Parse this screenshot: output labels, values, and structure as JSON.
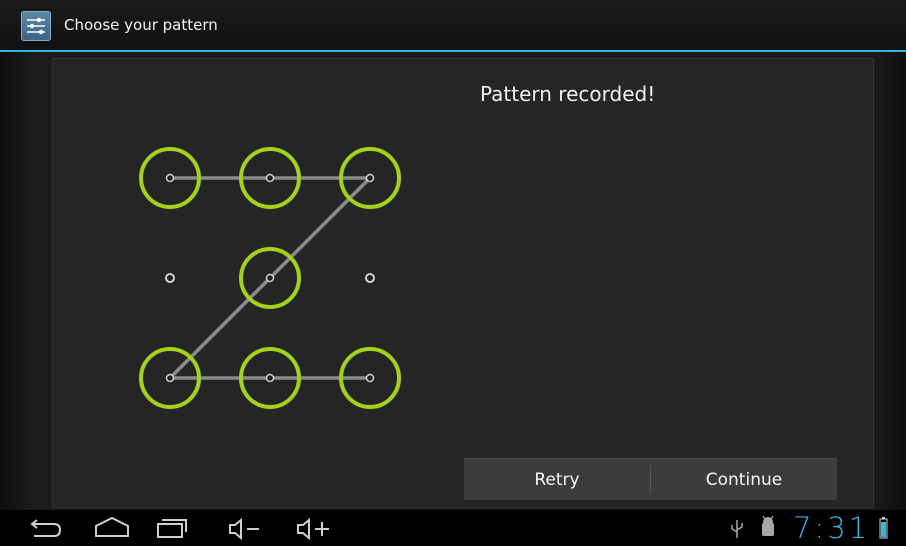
{
  "action_bar": {
    "title": "Choose your pattern",
    "app_icon": "settings-sliders-icon"
  },
  "status_message": "Pattern recorded!",
  "buttons": {
    "retry": "Retry",
    "continue": "Continue"
  },
  "pattern": {
    "sequence": [
      1,
      2,
      3,
      5,
      7,
      8,
      9
    ],
    "active_color": "#a4d21a",
    "line_color": "#9e9e9e"
  },
  "system_bar": {
    "time": "7:31",
    "icons": [
      "back-icon",
      "home-icon",
      "recent-apps-icon",
      "volume-down-icon",
      "volume-up-icon",
      "usb-icon",
      "android-debug-icon",
      "battery-icon"
    ]
  },
  "accent_color": "#33b5e5"
}
